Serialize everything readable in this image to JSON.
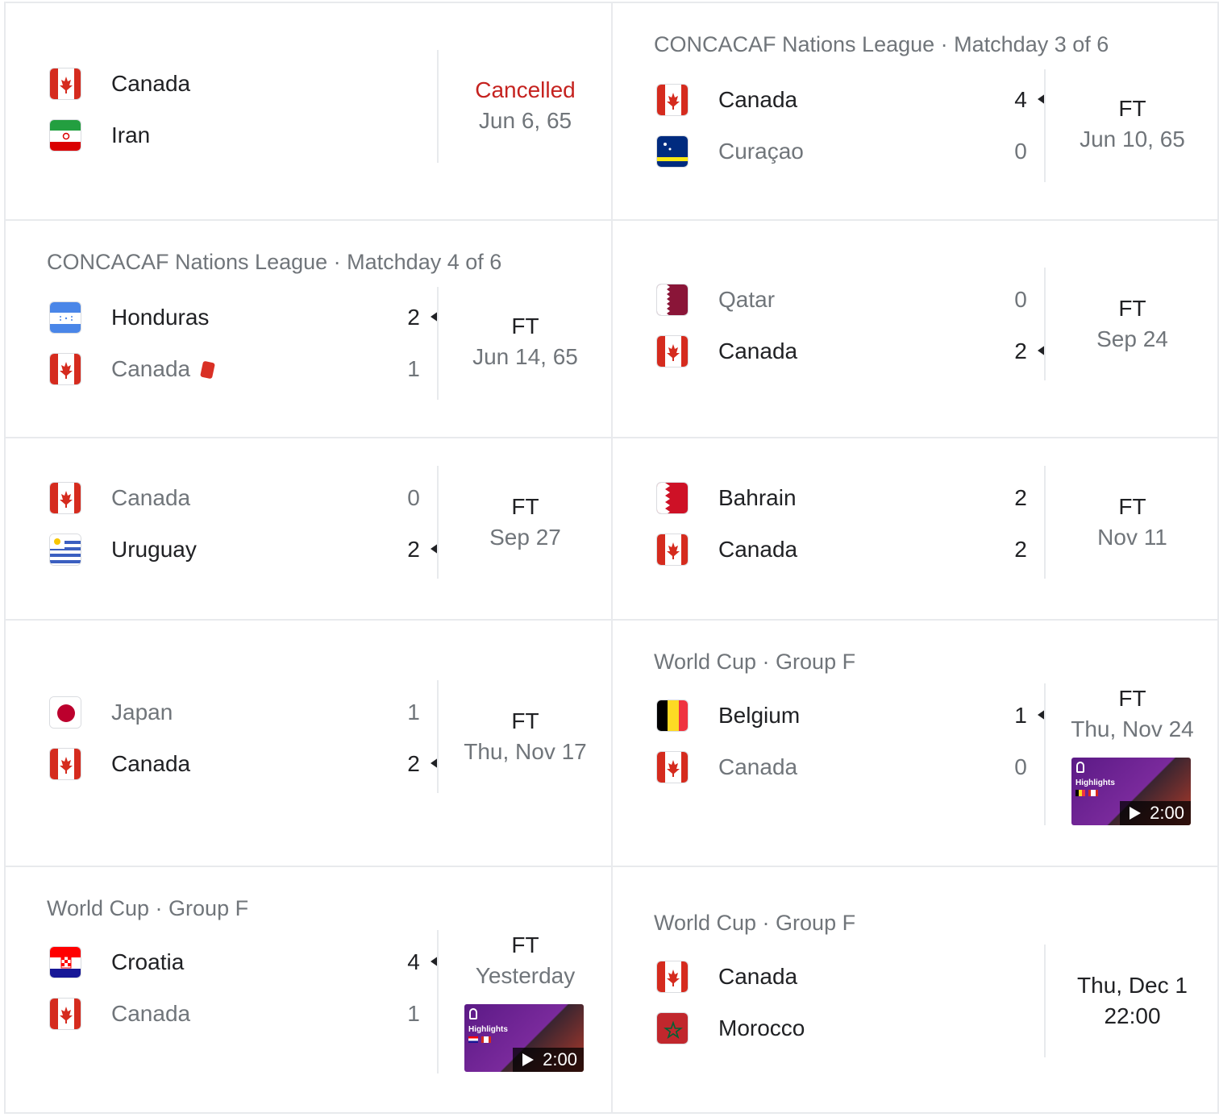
{
  "matches": [
    {
      "league": "",
      "teams": [
        {
          "name": "Canada",
          "flag": "canada",
          "score": "",
          "winner": false,
          "dim": false
        },
        {
          "name": "Iran",
          "flag": "iran",
          "score": "",
          "winner": false,
          "dim": false
        }
      ],
      "status": "Cancelled",
      "date": "Jun 6, 65"
    },
    {
      "league": "CONCACAF Nations League · Matchday 3 of 6",
      "teams": [
        {
          "name": "Canada",
          "flag": "canada",
          "score": "4",
          "winner": true,
          "dim": false
        },
        {
          "name": "Curaçao",
          "flag": "curacao",
          "score": "0",
          "winner": false,
          "dim": true
        }
      ],
      "status": "FT",
      "date": "Jun 10, 65"
    },
    {
      "league": "CONCACAF Nations League · Matchday 4 of 6",
      "teams": [
        {
          "name": "Honduras",
          "flag": "honduras",
          "score": "2",
          "winner": true,
          "dim": false
        },
        {
          "name": "Canada",
          "flag": "canada",
          "score": "1",
          "winner": false,
          "dim": true,
          "red_card": true
        }
      ],
      "status": "FT",
      "date": "Jun 14, 65"
    },
    {
      "league": "",
      "teams": [
        {
          "name": "Qatar",
          "flag": "qatar",
          "score": "0",
          "winner": false,
          "dim": true
        },
        {
          "name": "Canada",
          "flag": "canada",
          "score": "2",
          "winner": true,
          "dim": false
        }
      ],
      "status": "FT",
      "date": "Sep 24"
    },
    {
      "league": "",
      "teams": [
        {
          "name": "Canada",
          "flag": "canada",
          "score": "0",
          "winner": false,
          "dim": true
        },
        {
          "name": "Uruguay",
          "flag": "uruguay",
          "score": "2",
          "winner": true,
          "dim": false
        }
      ],
      "status": "FT",
      "date": "Sep 27"
    },
    {
      "league": "",
      "teams": [
        {
          "name": "Bahrain",
          "flag": "bahrain",
          "score": "2",
          "winner": false,
          "dim": false
        },
        {
          "name": "Canada",
          "flag": "canada",
          "score": "2",
          "winner": false,
          "dim": false
        }
      ],
      "status": "FT",
      "date": "Nov 11"
    },
    {
      "league": "",
      "teams": [
        {
          "name": "Japan",
          "flag": "japan",
          "score": "1",
          "winner": false,
          "dim": true
        },
        {
          "name": "Canada",
          "flag": "canada",
          "score": "2",
          "winner": true,
          "dim": false
        }
      ],
      "status": "FT",
      "date": "Thu, Nov 17"
    },
    {
      "league": "World Cup · Group F",
      "teams": [
        {
          "name": "Belgium",
          "flag": "belgium",
          "score": "1",
          "winner": true,
          "dim": false
        },
        {
          "name": "Canada",
          "flag": "canada",
          "score": "0",
          "winner": false,
          "dim": true
        }
      ],
      "status": "FT",
      "date": "Thu, Nov 24",
      "highlights": {
        "label": "Highlights",
        "duration": "2:00"
      }
    },
    {
      "league": "World Cup · Group F",
      "teams": [
        {
          "name": "Croatia",
          "flag": "croatia",
          "score": "4",
          "winner": true,
          "dim": false
        },
        {
          "name": "Canada",
          "flag": "canada",
          "score": "1",
          "winner": false,
          "dim": true
        }
      ],
      "status": "FT",
      "date": "Yesterday",
      "highlights": {
        "label": "Highlights",
        "duration": "2:00"
      }
    },
    {
      "league": "World Cup · Group F",
      "teams": [
        {
          "name": "Canada",
          "flag": "canada",
          "score": "",
          "winner": false,
          "dim": false
        },
        {
          "name": "Morocco",
          "flag": "morocco",
          "score": "",
          "winner": false,
          "dim": false
        }
      ],
      "status": "Thu, Dec 1",
      "date": "22:00",
      "upcoming": true
    }
  ],
  "colors": {
    "cancelled": "#c5221f",
    "muted": "#70757a",
    "text": "#202124",
    "divider": "#e8eaed"
  }
}
